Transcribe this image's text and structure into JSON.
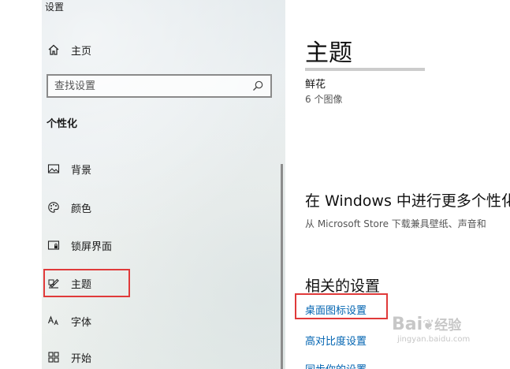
{
  "app": {
    "title": "设置"
  },
  "sidebar": {
    "home_label": "主页",
    "search_placeholder": "查找设置",
    "section_title": "个性化",
    "items": [
      {
        "label": "背景",
        "icon": "picture-icon"
      },
      {
        "label": "颜色",
        "icon": "palette-icon"
      },
      {
        "label": "锁屏界面",
        "icon": "lock-screen-icon"
      },
      {
        "label": "主题",
        "icon": "brush-icon",
        "selected": true
      },
      {
        "label": "字体",
        "icon": "font-icon"
      },
      {
        "label": "开始",
        "icon": "start-icon"
      }
    ]
  },
  "main": {
    "title": "主题",
    "current_theme": {
      "name": "鲜花",
      "count": "6 个图像"
    },
    "more": {
      "title": "在 Windows 中进行更多个性化",
      "description": "从 Microsoft Store 下载兼具壁纸、声音和"
    },
    "related": {
      "title": "相关的设置",
      "links": [
        "桌面图标设置",
        "高对比度设置",
        "同步你的设置"
      ]
    }
  },
  "watermark": {
    "brand": "Bai",
    "brand_suffix": "经验",
    "url": "jingyan.baidu.com"
  },
  "colors": {
    "accent_link": "#0063b1",
    "highlight": "#e03a3a"
  }
}
